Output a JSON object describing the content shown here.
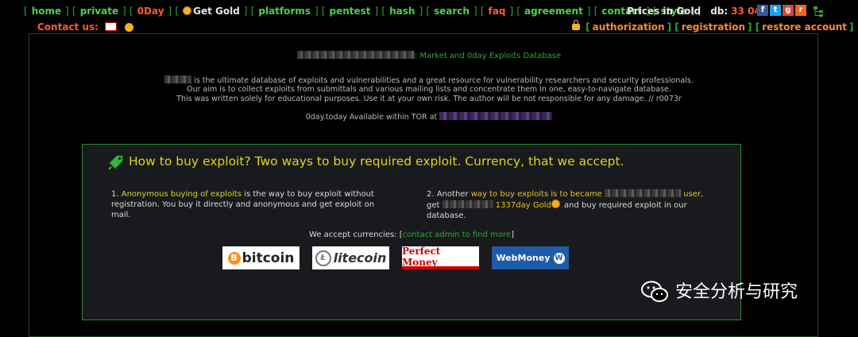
{
  "nav": {
    "links": [
      {
        "label": "home",
        "tone": "green"
      },
      {
        "label": "private",
        "tone": "green"
      },
      {
        "label": "0Day",
        "tone": "red"
      },
      {
        "label": "Get Gold",
        "tone": "gold"
      },
      {
        "label": "platforms",
        "tone": "green"
      },
      {
        "label": "pentest",
        "tone": "green"
      },
      {
        "label": "hash",
        "tone": "green"
      },
      {
        "label": "search",
        "tone": "green"
      },
      {
        "label": "faq",
        "tone": "red"
      },
      {
        "label": "agreement",
        "tone": "green"
      },
      {
        "label": "contact",
        "tone": "green"
      },
      {
        "label": "style",
        "tone": "green"
      }
    ],
    "prices_label": "Prices in Gold",
    "db_label": "db:",
    "db_value": "33 042"
  },
  "contact_label": "Contact us:",
  "auth": {
    "authorization": "authorization",
    "registration": "registration",
    "restore": "restore account"
  },
  "intro": {
    "title_suffix": ": Market and 0day Exploits Database",
    "line1": "is the ultimate database of exploits and vulnerabilities and a great resource for vulnerability researchers and security professionals.",
    "line2": "Our aim is to collect exploits from submittals and various mailing lists and concentrate them in one, easy-to-navigate database.",
    "line3": "This was written solely for educational purposes. Use it at your own risk. The author will be not responsible for any damage. // r0073r",
    "tor": "0day.today Available within TOR at"
  },
  "panel": {
    "title": "How to buy exploit? Two ways to buy required exploit. Currency, that we accept.",
    "one_num": "1.",
    "one_hl": "Anonymous buying of exploits",
    "one_rest": "is the way to buy exploit without registration. You buy it directly and anonymous and get exploit on mail.",
    "two_num": "2. Another",
    "two_hl": "way to buy exploits is to became",
    "two_tail": "user,",
    "two_get": "get",
    "two_gold": "1337day Gold",
    "two_rest": "and buy required exploit in our database.",
    "accept_label": "We accept currencies:",
    "accept_link": "contact admin to find more",
    "currencies": [
      "bitcoin",
      "litecoin",
      "Perfect Money",
      "WebMoney"
    ]
  },
  "watermark": "安全分析与研究",
  "colors": {
    "bg": "#000000",
    "green": "#2fa82f",
    "orange": "#ff5c2e",
    "yellow": "#d8d818"
  }
}
